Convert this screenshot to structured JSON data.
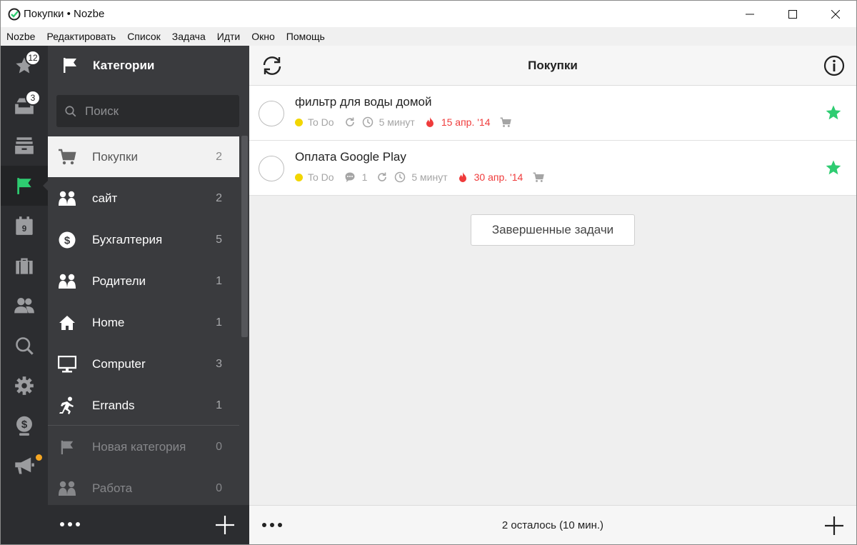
{
  "window": {
    "title": "Покупки • Nozbe"
  },
  "menu": [
    "Nozbe",
    "Редактировать",
    "Список",
    "Задача",
    "Идти",
    "Окно",
    "Помощь"
  ],
  "iconbar": {
    "priority_badge": "12",
    "inbox_badge": "3",
    "calendar_day": "9"
  },
  "categories": {
    "title": "Категории",
    "search_placeholder": "Поиск",
    "items": [
      {
        "label": "Покупки",
        "count": "2",
        "icon": "cart-icon"
      },
      {
        "label": "сайт",
        "count": "2",
        "icon": "people-icon"
      },
      {
        "label": "Бухгалтерия",
        "count": "5",
        "icon": "dollar-icon"
      },
      {
        "label": "Родители",
        "count": "1",
        "icon": "people-icon"
      },
      {
        "label": "Home",
        "count": "1",
        "icon": "home-icon"
      },
      {
        "label": "Computer",
        "count": "3",
        "icon": "monitor-icon"
      },
      {
        "label": "Errands",
        "count": "1",
        "icon": "runner-icon"
      },
      {
        "label": "Новая категория",
        "count": "0",
        "icon": "flag-icon"
      },
      {
        "label": "Работа",
        "count": "0",
        "icon": "people-icon"
      }
    ]
  },
  "main": {
    "title": "Покупки",
    "tasks": [
      {
        "name": "фильтр для воды домой",
        "project": "To Do",
        "comments": "",
        "time": "5 минут",
        "due": "15 апр. '14"
      },
      {
        "name": "Оплата Google Play",
        "project": "To Do",
        "comments": "1",
        "time": "5 минут",
        "due": "30 апр. '14"
      }
    ],
    "completed_button": "Завершенные задачи",
    "footer_status": "2 осталось (10 мин.)"
  },
  "colors": {
    "accent_green": "#2ecc71",
    "due_red": "#ef3b3b",
    "project_yellow": "#f2d600"
  }
}
